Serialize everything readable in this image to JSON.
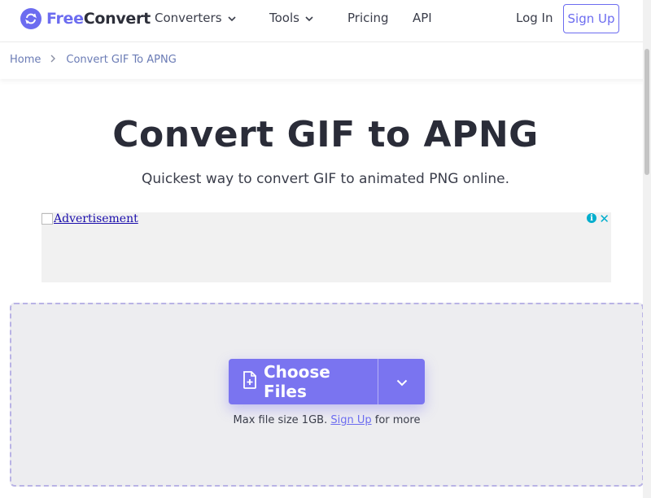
{
  "header": {
    "logo_free": "Free",
    "logo_convert": "Convert",
    "nav": {
      "converters": "Converters",
      "tools": "Tools",
      "pricing": "Pricing",
      "api": "API"
    },
    "login": "Log In",
    "signup": "Sign Up"
  },
  "breadcrumb": {
    "home": "Home",
    "current": "Convert GIF To APNG"
  },
  "main": {
    "title": "Convert GIF to APNG",
    "subtitle": "Quickest way to convert GIF to animated PNG online."
  },
  "ad": {
    "alt_text": "Advertisement",
    "info": "i",
    "close": "✕"
  },
  "upload": {
    "choose_label": "Choose Files",
    "note_prefix": "Max file size 1GB.",
    "note_link": "Sign Up",
    "note_suffix": "for more"
  },
  "colors": {
    "brand": "#6c6cf0",
    "button": "#7a74f0",
    "dropzone_bg": "#ededf0",
    "dropzone_border": "#b9b3e5"
  }
}
